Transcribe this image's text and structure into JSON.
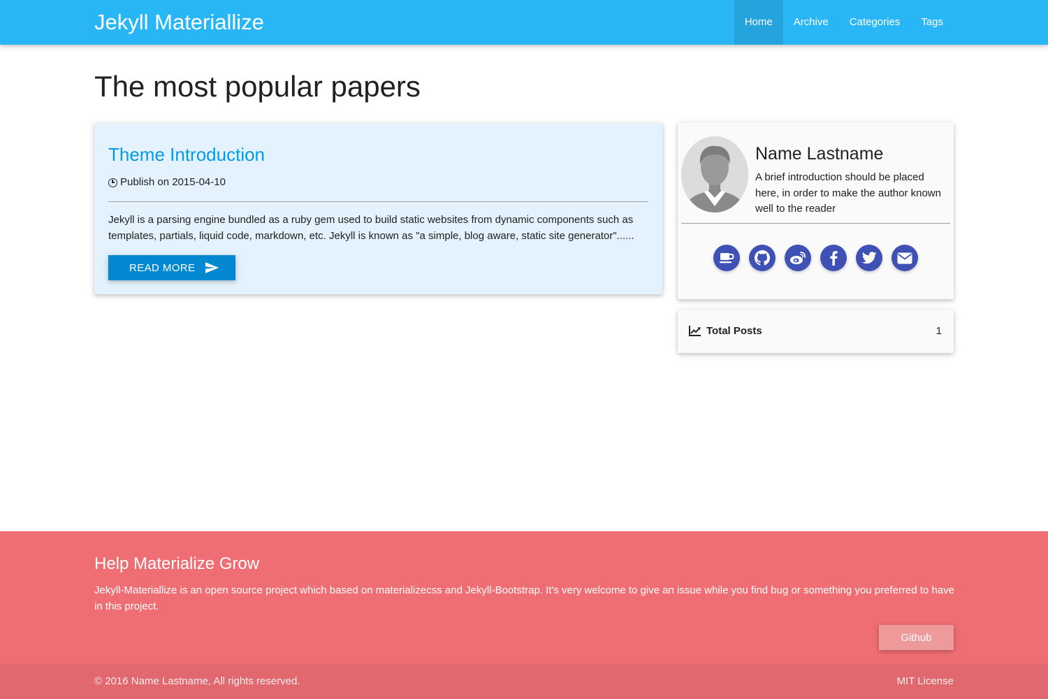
{
  "navbar": {
    "brand": "Jekyll Materiallize",
    "links": [
      {
        "label": "Home",
        "active": true
      },
      {
        "label": "Archive",
        "active": false
      },
      {
        "label": "Categories",
        "active": false
      },
      {
        "label": "Tags",
        "active": false
      }
    ]
  },
  "page": {
    "title": "The most popular papers"
  },
  "post": {
    "title": "Theme Introduction",
    "meta": "Publish on 2015-04-10",
    "excerpt": "Jekyll is a parsing engine bundled as a ruby gem used to build static websites from dynamic components such as templates, partials, liquid code, markdown, etc. Jekyll is known as \"a simple, blog aware, static site generator\"......",
    "read_more": "READ MORE",
    "read_more_icon": "send-icon",
    "meta_icon": "clock-icon"
  },
  "profile": {
    "name": "Name Lastname",
    "bio": "A brief introduction should be placed here, in order to make the author known well to the reader",
    "social": [
      "coffee-icon",
      "github-icon",
      "weibo-icon",
      "facebook-icon",
      "twitter-icon",
      "email-icon"
    ],
    "social_color": "#3f51b5"
  },
  "stats": {
    "label": "Total Posts",
    "value": "1",
    "icon": "line-chart-icon"
  },
  "footer": {
    "title": "Help Materialize Grow",
    "text": "Jekyll-Materiallize is an open source project which based on materializecss and Jekyll-Bootstrap. It's very welcome to give an issue while you find bug or something you preferred to have in this project.",
    "github_label": "Github",
    "copyright": "© 2016 Name Lastname, All rights reserved.",
    "license": "MIT License"
  },
  "colors": {
    "navbar": "#29b6f6",
    "post_card": "#e3f2fd",
    "post_title": "#039be5",
    "read_more": "#0288d1",
    "footer": "#ef6e73",
    "footer_bottom": "#e0686e",
    "github_button": "#ef9a9a"
  }
}
